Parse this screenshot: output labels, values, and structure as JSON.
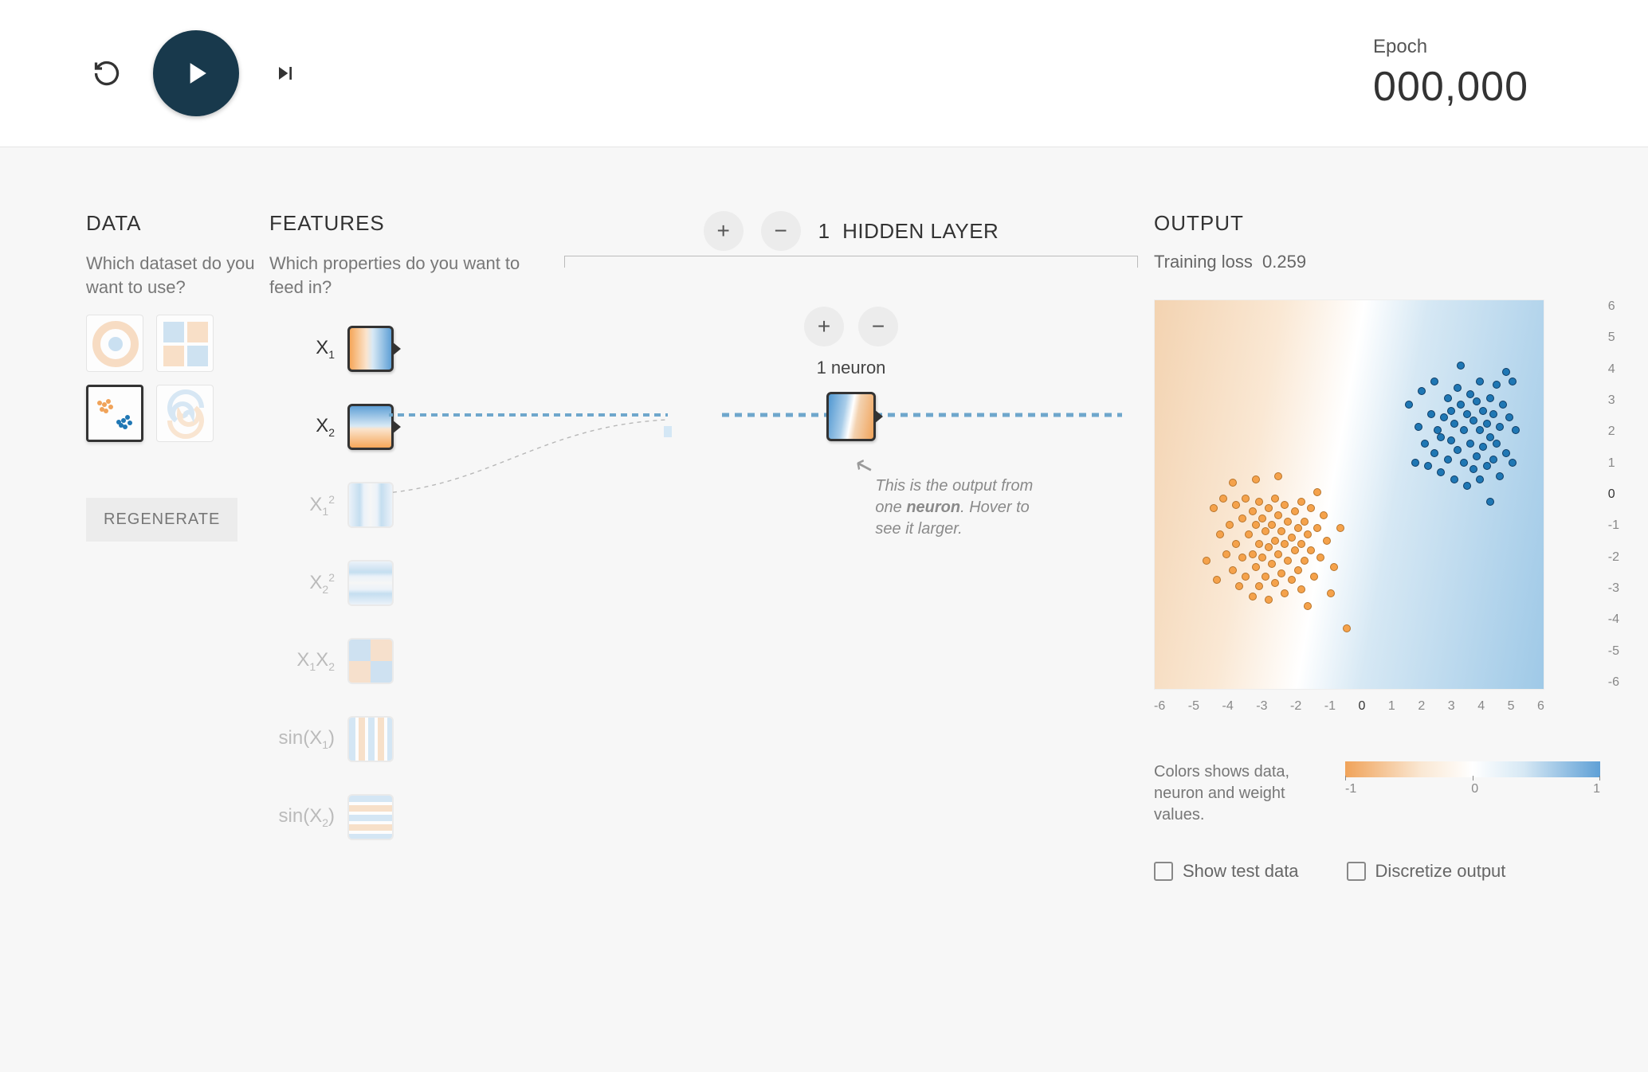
{
  "topbar": {
    "epoch_label": "Epoch",
    "epoch_value": "000,000"
  },
  "data": {
    "title": "DATA",
    "subtitle": "Which dataset do you want to use?",
    "datasets": [
      "circle",
      "xor",
      "gauss",
      "spiral"
    ],
    "selected_dataset": "gauss",
    "regenerate_label": "REGENERATE"
  },
  "features": {
    "title": "FEATURES",
    "subtitle": "Which properties do you want to feed in?",
    "items": [
      {
        "id": "x1",
        "label_html": "X₁",
        "active": true,
        "grad": "grad-x1"
      },
      {
        "id": "x2",
        "label_html": "X₂",
        "active": true,
        "grad": "grad-x2"
      },
      {
        "id": "x1sq",
        "label_html": "X₁²",
        "active": false,
        "grad": "grad-x1sq"
      },
      {
        "id": "x2sq",
        "label_html": "X₂²",
        "active": false,
        "grad": "grad-x2sq"
      },
      {
        "id": "x1x2",
        "label_html": "X₁X₂",
        "active": false,
        "grad": "grad-x1x2"
      },
      {
        "id": "sinx1",
        "label_html": "sin(X₁)",
        "active": false,
        "grad": "grad-sinx1"
      },
      {
        "id": "sinx2",
        "label_html": "sin(X₂)",
        "active": false,
        "grad": "grad-sinx2"
      }
    ]
  },
  "network": {
    "hidden_layer_count": "1",
    "hidden_layer_label": "HIDDEN LAYER",
    "neuron_count_label": "1 neuron",
    "callout_pre": "This is the output from one ",
    "callout_bold": "neuron",
    "callout_post": ". Hover to see it larger."
  },
  "output": {
    "title": "OUTPUT",
    "training_loss_label": "Training loss",
    "training_loss_value": "0.259",
    "legend_text": "Colors shows data, neuron and weight values.",
    "colorbar_ticks": [
      "-1",
      "0",
      "1"
    ],
    "axis_ticks": [
      "-6",
      "-5",
      "-4",
      "-3",
      "-2",
      "-1",
      "0",
      "1",
      "2",
      "3",
      "4",
      "5",
      "6"
    ],
    "show_test_label": "Show test data",
    "discretize_label": "Discretize output",
    "show_test_checked": false,
    "discretize_checked": false
  },
  "chart_data": {
    "type": "scatter",
    "title": "",
    "xlabel": "",
    "ylabel": "",
    "xlim": [
      -6,
      6
    ],
    "ylim": [
      -6,
      6
    ],
    "series": [
      {
        "name": "class-blue",
        "color": "#1f77b4",
        "points": [
          [
            2.0,
            1.0
          ],
          [
            2.1,
            2.1
          ],
          [
            2.3,
            1.6
          ],
          [
            2.4,
            0.9
          ],
          [
            2.5,
            2.5
          ],
          [
            2.6,
            1.3
          ],
          [
            2.7,
            2.0
          ],
          [
            2.8,
            0.7
          ],
          [
            2.8,
            1.8
          ],
          [
            2.9,
            2.4
          ],
          [
            3.0,
            1.1
          ],
          [
            3.0,
            3.0
          ],
          [
            3.1,
            1.7
          ],
          [
            3.1,
            2.6
          ],
          [
            3.2,
            0.5
          ],
          [
            3.2,
            2.2
          ],
          [
            3.3,
            1.4
          ],
          [
            3.3,
            3.3
          ],
          [
            3.4,
            2.8
          ],
          [
            3.5,
            1.0
          ],
          [
            3.5,
            2.0
          ],
          [
            3.6,
            0.3
          ],
          [
            3.6,
            2.5
          ],
          [
            3.7,
            1.6
          ],
          [
            3.7,
            3.1
          ],
          [
            3.8,
            0.8
          ],
          [
            3.8,
            2.3
          ],
          [
            3.9,
            1.2
          ],
          [
            3.9,
            2.9
          ],
          [
            4.0,
            0.5
          ],
          [
            4.0,
            2.0
          ],
          [
            4.0,
            3.5
          ],
          [
            4.1,
            1.5
          ],
          [
            4.1,
            2.6
          ],
          [
            4.2,
            0.9
          ],
          [
            4.2,
            2.2
          ],
          [
            4.3,
            1.8
          ],
          [
            4.3,
            3.0
          ],
          [
            4.4,
            1.1
          ],
          [
            4.4,
            2.5
          ],
          [
            4.5,
            1.6
          ],
          [
            4.5,
            3.4
          ],
          [
            4.6,
            2.1
          ],
          [
            4.7,
            2.8
          ],
          [
            4.8,
            1.3
          ],
          [
            4.9,
            2.4
          ],
          [
            5.0,
            3.5
          ],
          [
            5.1,
            2.0
          ],
          [
            1.8,
            2.8
          ],
          [
            2.2,
            3.2
          ],
          [
            2.6,
            3.5
          ],
          [
            4.3,
            -0.2
          ],
          [
            4.6,
            0.6
          ],
          [
            5.0,
            1.0
          ],
          [
            3.4,
            4.0
          ],
          [
            4.8,
            3.8
          ]
        ]
      },
      {
        "name": "class-orange",
        "color": "#f5a24b",
        "points": [
          [
            -4.2,
            -0.4
          ],
          [
            -4.0,
            -1.2
          ],
          [
            -3.9,
            -0.1
          ],
          [
            -3.8,
            -1.8
          ],
          [
            -3.7,
            -0.9
          ],
          [
            -3.6,
            -2.3
          ],
          [
            -3.5,
            -0.3
          ],
          [
            -3.5,
            -1.5
          ],
          [
            -3.4,
            -2.8
          ],
          [
            -3.3,
            -0.7
          ],
          [
            -3.3,
            -1.9
          ],
          [
            -3.2,
            -0.1
          ],
          [
            -3.2,
            -2.5
          ],
          [
            -3.1,
            -1.2
          ],
          [
            -3.0,
            -0.5
          ],
          [
            -3.0,
            -1.8
          ],
          [
            -3.0,
            -3.1
          ],
          [
            -2.9,
            -0.9
          ],
          [
            -2.9,
            -2.2
          ],
          [
            -2.8,
            -0.2
          ],
          [
            -2.8,
            -1.5
          ],
          [
            -2.8,
            -2.8
          ],
          [
            -2.7,
            -0.7
          ],
          [
            -2.7,
            -1.9
          ],
          [
            -2.6,
            -1.1
          ],
          [
            -2.6,
            -2.5
          ],
          [
            -2.5,
            -0.4
          ],
          [
            -2.5,
            -1.6
          ],
          [
            -2.5,
            -3.2
          ],
          [
            -2.4,
            -0.9
          ],
          [
            -2.4,
            -2.1
          ],
          [
            -2.3,
            -0.1
          ],
          [
            -2.3,
            -1.4
          ],
          [
            -2.3,
            -2.7
          ],
          [
            -2.2,
            -0.6
          ],
          [
            -2.2,
            -1.8
          ],
          [
            -2.1,
            -1.1
          ],
          [
            -2.1,
            -2.4
          ],
          [
            -2.0,
            -0.3
          ],
          [
            -2.0,
            -1.5
          ],
          [
            -2.0,
            -3.0
          ],
          [
            -1.9,
            -0.8
          ],
          [
            -1.9,
            -2.0
          ],
          [
            -1.8,
            -1.3
          ],
          [
            -1.8,
            -2.6
          ],
          [
            -1.7,
            -0.5
          ],
          [
            -1.7,
            -1.7
          ],
          [
            -1.6,
            -1.0
          ],
          [
            -1.6,
            -2.3
          ],
          [
            -1.5,
            -0.2
          ],
          [
            -1.5,
            -1.5
          ],
          [
            -1.5,
            -2.9
          ],
          [
            -1.4,
            -0.8
          ],
          [
            -1.4,
            -2.0
          ],
          [
            -1.3,
            -1.2
          ],
          [
            -1.2,
            -0.4
          ],
          [
            -1.2,
            -1.7
          ],
          [
            -1.1,
            -2.5
          ],
          [
            -1.0,
            -1.0
          ],
          [
            -0.9,
            -1.9
          ],
          [
            -0.8,
            -0.6
          ],
          [
            -0.7,
            -1.4
          ],
          [
            -0.5,
            -2.2
          ],
          [
            -0.3,
            -1.0
          ],
          [
            -0.1,
            -4.1
          ],
          [
            -4.4,
            -2.0
          ],
          [
            -4.1,
            -2.6
          ],
          [
            -3.6,
            0.4
          ],
          [
            -2.9,
            0.5
          ],
          [
            -2.2,
            0.6
          ],
          [
            -1.0,
            0.1
          ],
          [
            -0.6,
            -3.0
          ],
          [
            -1.3,
            -3.4
          ]
        ]
      }
    ]
  }
}
